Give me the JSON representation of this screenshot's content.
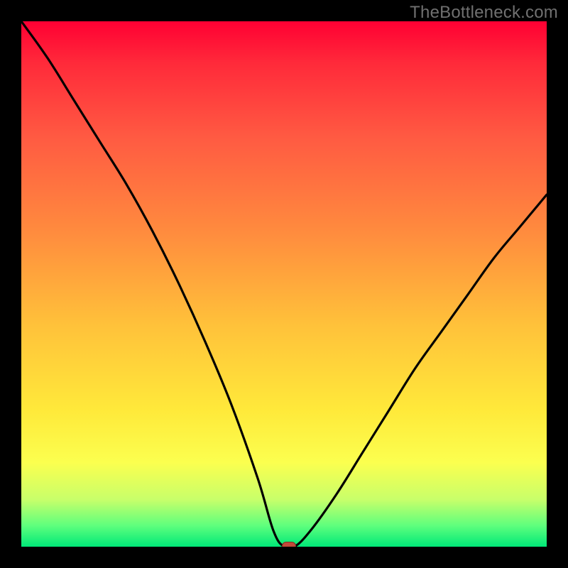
{
  "watermark": "TheBottleneck.com",
  "chart_data": {
    "type": "line",
    "title": "",
    "xlabel": "",
    "ylabel": "",
    "xlim": [
      0,
      100
    ],
    "ylim": [
      0,
      100
    ],
    "grid": false,
    "series": [
      {
        "name": "bottleneck-curve",
        "x": [
          0,
          5,
          10,
          15,
          20,
          25,
          30,
          35,
          40,
          45,
          48,
          50,
          52,
          55,
          60,
          65,
          70,
          75,
          80,
          85,
          90,
          95,
          100
        ],
        "values": [
          100,
          93,
          85,
          77,
          69,
          60,
          50,
          39,
          27,
          13,
          3,
          0,
          0,
          3,
          10,
          18,
          26,
          34,
          41,
          48,
          55,
          61,
          67
        ]
      }
    ],
    "marker": {
      "x": 51,
      "y": 0
    },
    "background_gradient": {
      "direction": "vertical",
      "stops": [
        {
          "pos": 0.0,
          "color": "#ff0033"
        },
        {
          "pos": 0.4,
          "color": "#ff8b3e"
        },
        {
          "pos": 0.74,
          "color": "#ffe93a"
        },
        {
          "pos": 0.96,
          "color": "#5eff7d"
        },
        {
          "pos": 1.0,
          "color": "#00e878"
        }
      ]
    }
  }
}
